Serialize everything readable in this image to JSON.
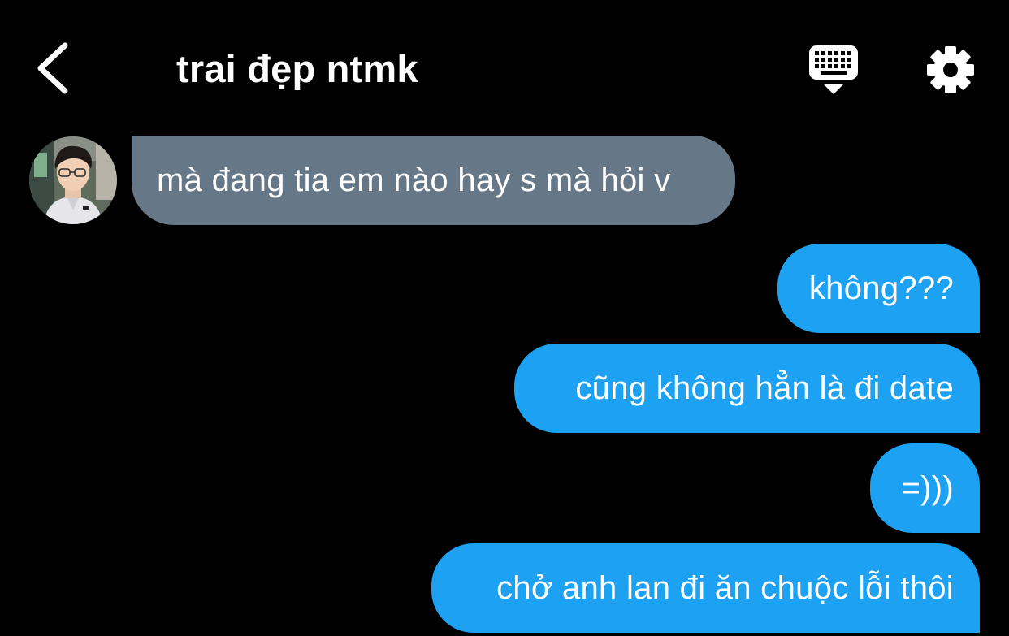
{
  "header": {
    "title": "trai đẹp ntmk",
    "back_icon": "chevron-left-icon",
    "keyboard_icon": "keyboard-icon",
    "settings_icon": "gear-icon"
  },
  "colors": {
    "background": "#000000",
    "incoming_bubble": "#667788",
    "outgoing_bubble": "#1da1f2",
    "text": "#ffffff"
  },
  "messages": [
    {
      "direction": "incoming",
      "text": "mà đang tia em nào hay s mà hỏi v"
    },
    {
      "direction": "outgoing",
      "text": "không???"
    },
    {
      "direction": "outgoing",
      "text": "cũng không hẳn là đi date"
    },
    {
      "direction": "outgoing",
      "text": "=)))"
    },
    {
      "direction": "outgoing",
      "text": "chở anh lan đi ăn chuộc lỗi thôi"
    }
  ]
}
